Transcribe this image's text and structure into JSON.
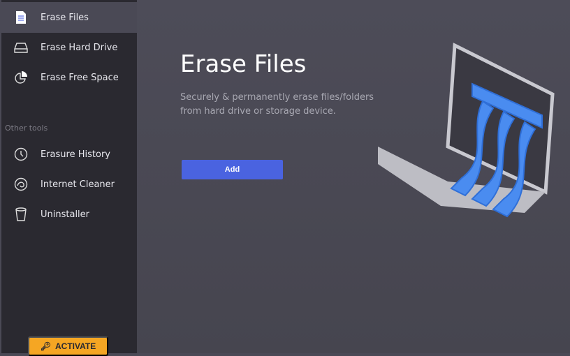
{
  "sidebar": {
    "items": [
      {
        "label": "Erase Files"
      },
      {
        "label": "Erase Hard Drive"
      },
      {
        "label": "Erase Free Space"
      }
    ],
    "section": "Other tools",
    "tools": [
      {
        "label": "Erasure History"
      },
      {
        "label": "Internet Cleaner"
      },
      {
        "label": "Uninstaller"
      }
    ],
    "activate": "ACTIVATE"
  },
  "main": {
    "title": "Erase Files",
    "description": "Securely & permanently erase files/folders from hard drive or storage device.",
    "add_label": "Add"
  },
  "colors": {
    "accent": "#4a63e0",
    "activate": "#f5a623"
  }
}
